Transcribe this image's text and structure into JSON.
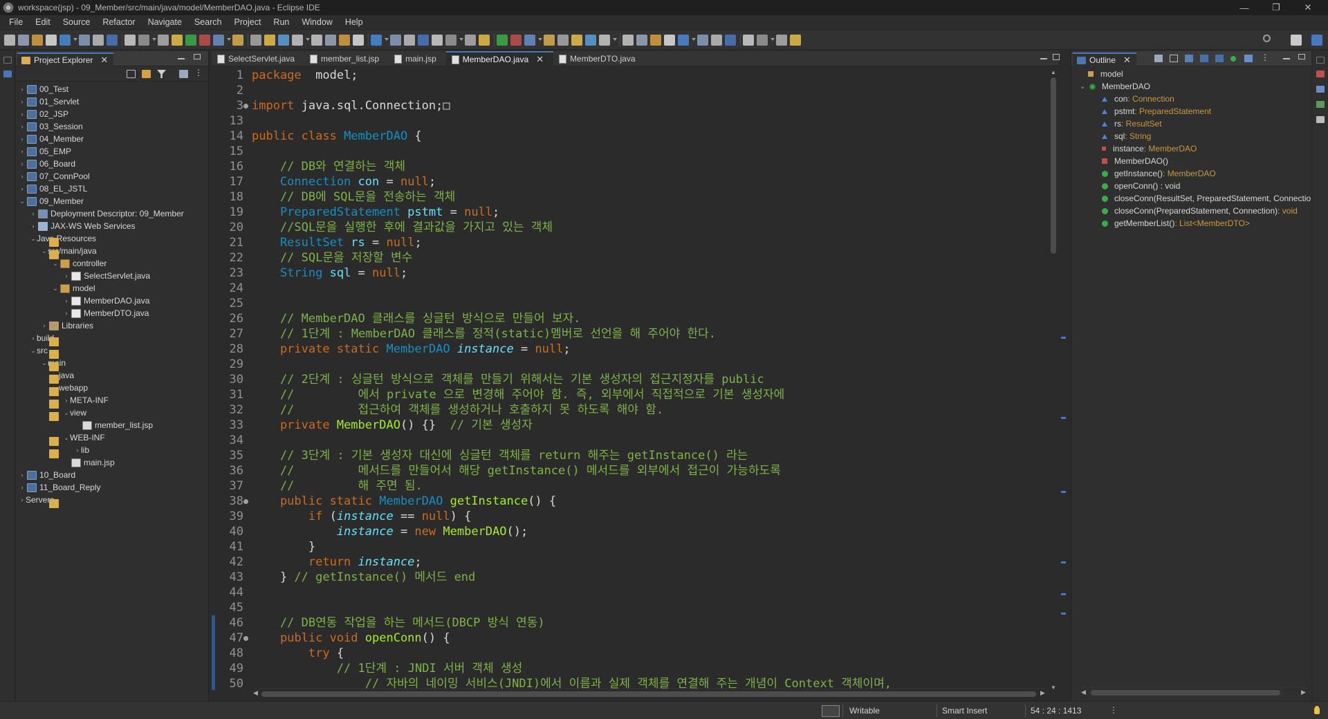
{
  "window": {
    "title": "workspace(jsp) - 09_Member/src/main/java/model/MemberDAO.java - Eclipse IDE",
    "minimize": "—",
    "restore": "❐",
    "close": "✕"
  },
  "menu": [
    "File",
    "Edit",
    "Source",
    "Refactor",
    "Navigate",
    "Search",
    "Project",
    "Run",
    "Window",
    "Help"
  ],
  "explorer": {
    "title": "Project Explorer",
    "close": "✕",
    "tree": [
      {
        "indent": 0,
        "arrow": "›",
        "icon": "proj",
        "label": "00_Test"
      },
      {
        "indent": 0,
        "arrow": "›",
        "icon": "proj",
        "label": "01_Servlet"
      },
      {
        "indent": 0,
        "arrow": "›",
        "icon": "proj",
        "label": "02_JSP"
      },
      {
        "indent": 0,
        "arrow": "›",
        "icon": "proj",
        "label": "03_Session"
      },
      {
        "indent": 0,
        "arrow": "›",
        "icon": "proj",
        "label": "04_Member"
      },
      {
        "indent": 0,
        "arrow": "›",
        "icon": "proj",
        "label": "05_EMP"
      },
      {
        "indent": 0,
        "arrow": "›",
        "icon": "proj",
        "label": "06_Board"
      },
      {
        "indent": 0,
        "arrow": "›",
        "icon": "proj",
        "label": "07_ConnPool"
      },
      {
        "indent": 0,
        "arrow": "›",
        "icon": "proj",
        "label": "08_EL_JSTL"
      },
      {
        "indent": 0,
        "arrow": "⌄",
        "icon": "proj",
        "label": "09_Member"
      },
      {
        "indent": 1,
        "arrow": "›",
        "icon": "dd",
        "label": "Deployment Descriptor: 09_Member"
      },
      {
        "indent": 1,
        "arrow": "›",
        "icon": "ws",
        "label": "JAX-WS Web Services"
      },
      {
        "indent": 1,
        "arrow": "⌄",
        "icon": "fold",
        "label": "Java Resources"
      },
      {
        "indent": 2,
        "arrow": "⌄",
        "icon": "fold",
        "label": "src/main/java"
      },
      {
        "indent": 3,
        "arrow": "⌄",
        "icon": "pkg",
        "label": "controller"
      },
      {
        "indent": 4,
        "arrow": "›",
        "icon": "java",
        "label": "SelectServlet.java"
      },
      {
        "indent": 3,
        "arrow": "⌄",
        "icon": "pkg",
        "label": "model"
      },
      {
        "indent": 4,
        "arrow": "›",
        "icon": "java",
        "label": "MemberDAO.java"
      },
      {
        "indent": 4,
        "arrow": "›",
        "icon": "java",
        "label": "MemberDTO.java"
      },
      {
        "indent": 2,
        "arrow": "›",
        "icon": "lib",
        "label": "Libraries"
      },
      {
        "indent": 1,
        "arrow": "›",
        "icon": "fold",
        "label": "build"
      },
      {
        "indent": 1,
        "arrow": "⌄",
        "icon": "fold",
        "label": "src"
      },
      {
        "indent": 2,
        "arrow": "⌄",
        "icon": "fold",
        "label": "main"
      },
      {
        "indent": 3,
        "arrow": "›",
        "icon": "fold",
        "label": "java"
      },
      {
        "indent": 3,
        "arrow": "⌄",
        "icon": "fold",
        "label": "webapp"
      },
      {
        "indent": 4,
        "arrow": "›",
        "icon": "fold",
        "label": "META-INF"
      },
      {
        "indent": 4,
        "arrow": "⌄",
        "icon": "fold",
        "label": "view"
      },
      {
        "indent": 5,
        "arrow": "",
        "icon": "jsp",
        "label": "member_list.jsp"
      },
      {
        "indent": 4,
        "arrow": "⌄",
        "icon": "fold",
        "label": "WEB-INF"
      },
      {
        "indent": 5,
        "arrow": "›",
        "icon": "fold",
        "label": "lib"
      },
      {
        "indent": 4,
        "arrow": "",
        "icon": "jsp",
        "label": "main.jsp"
      },
      {
        "indent": 0,
        "arrow": "›",
        "icon": "proj",
        "label": "10_Board"
      },
      {
        "indent": 0,
        "arrow": "›",
        "icon": "proj",
        "label": "11_Board_Reply"
      },
      {
        "indent": 0,
        "arrow": "›",
        "icon": "fold",
        "label": "Servers"
      }
    ]
  },
  "editor": {
    "tabs": [
      {
        "label": "SelectServlet.java",
        "active": false
      },
      {
        "label": "member_list.jsp",
        "active": false
      },
      {
        "label": "main.jsp",
        "active": false
      },
      {
        "label": "MemberDAO.java",
        "active": true,
        "close": "✕"
      },
      {
        "label": "MemberDTO.java",
        "active": false
      }
    ],
    "lines": [
      {
        "n": "1",
        "t": [
          [
            "k",
            "package"
          ],
          [
            "",
            "  model;"
          ]
        ]
      },
      {
        "n": "2",
        "t": []
      },
      {
        "n": "3",
        "fold": true,
        "t": [
          [
            "k",
            "import"
          ],
          [
            "",
            " java.sql.Connection;"
          ],
          [
            "",
            "□"
          ]
        ]
      },
      {
        "n": "13",
        "t": []
      },
      {
        "n": "14",
        "t": [
          [
            "k",
            "public class "
          ],
          [
            "cls",
            "MemberDAO"
          ],
          [
            "",
            " {"
          ]
        ]
      },
      {
        "n": "15",
        "t": []
      },
      {
        "n": "16",
        "t": [
          [
            "c",
            "    // DB와 연결하는 객체"
          ]
        ]
      },
      {
        "n": "17",
        "t": [
          [
            "ty",
            "    Connection "
          ],
          [
            "v",
            "con"
          ],
          [
            "",
            " = "
          ],
          [
            "n",
            "null"
          ],
          [
            "",
            ";"
          ]
        ]
      },
      {
        "n": "18",
        "t": [
          [
            "c",
            "    // DB에 SQL문을 전송하는 객체"
          ]
        ]
      },
      {
        "n": "19",
        "t": [
          [
            "ty",
            "    PreparedStatement "
          ],
          [
            "v",
            "pstmt"
          ],
          [
            "",
            " = "
          ],
          [
            "n",
            "null"
          ],
          [
            "",
            ";"
          ]
        ]
      },
      {
        "n": "20",
        "t": [
          [
            "c",
            "    //SQL문을 실행한 후에 결과값을 가지고 있는 객체"
          ]
        ]
      },
      {
        "n": "21",
        "t": [
          [
            "ty",
            "    ResultSet "
          ],
          [
            "v",
            "rs"
          ],
          [
            "",
            " = "
          ],
          [
            "n",
            "null"
          ],
          [
            "",
            ";"
          ]
        ]
      },
      {
        "n": "22",
        "t": [
          [
            "c",
            "    // SQL문을 저장할 변수"
          ]
        ]
      },
      {
        "n": "23",
        "t": [
          [
            "ty",
            "    String "
          ],
          [
            "v",
            "sql"
          ],
          [
            "",
            " = "
          ],
          [
            "n",
            "null"
          ],
          [
            "",
            ";"
          ]
        ]
      },
      {
        "n": "24",
        "t": []
      },
      {
        "n": "25",
        "t": []
      },
      {
        "n": "26",
        "t": [
          [
            "c",
            "    // MemberDAO 클래스를 싱글턴 방식으로 만들어 보자."
          ]
        ]
      },
      {
        "n": "27",
        "t": [
          [
            "c",
            "    // 1단계 : MemberDAO 클래스를 정적(static)멤버로 선언을 해 주어야 한다."
          ]
        ]
      },
      {
        "n": "28",
        "t": [
          [
            "k",
            "    private static "
          ],
          [
            "cls",
            "MemberDAO "
          ],
          [
            "fi",
            "instance"
          ],
          [
            "",
            " = "
          ],
          [
            "n",
            "null"
          ],
          [
            "",
            ";"
          ]
        ]
      },
      {
        "n": "29",
        "t": []
      },
      {
        "n": "30",
        "t": [
          [
            "c",
            "    // 2단계 : 싱글턴 방식으로 객체를 만들기 위해서는 기본 생성자의 접근지정자를 public"
          ]
        ]
      },
      {
        "n": "31",
        "t": [
          [
            "c",
            "    //         에서 private 으로 변경해 주어야 함. 즉, 외부에서 직접적으로 기본 생성자에"
          ]
        ]
      },
      {
        "n": "32",
        "t": [
          [
            "c",
            "    //         접근하여 객체를 생성하거나 호출하지 못 하도록 해야 함."
          ]
        ]
      },
      {
        "n": "33",
        "t": [
          [
            "k",
            "    private "
          ],
          [
            "f",
            "MemberDAO"
          ],
          [
            "",
            "() {}  "
          ],
          [
            "c",
            "// 기본 생성자"
          ]
        ]
      },
      {
        "n": "34",
        "t": []
      },
      {
        "n": "35",
        "t": [
          [
            "c",
            "    // 3단계 : 기본 생성자 대신에 싱글턴 객체를 return 해주는 getInstance() 라는"
          ]
        ]
      },
      {
        "n": "36",
        "t": [
          [
            "c",
            "    //         메서드를 만들어서 해당 getInstance() 메서드를 외부에서 접근이 가능하도록"
          ]
        ]
      },
      {
        "n": "37",
        "t": [
          [
            "c",
            "    //         해 주면 됨."
          ]
        ]
      },
      {
        "n": "38",
        "fold": true,
        "t": [
          [
            "k",
            "    public static "
          ],
          [
            "cls",
            "MemberDAO "
          ],
          [
            "f",
            "getInstance"
          ],
          [
            "",
            "() {"
          ]
        ]
      },
      {
        "n": "39",
        "t": [
          [
            "k",
            "        if "
          ],
          [
            "",
            "("
          ],
          [
            "fi",
            "instance"
          ],
          [
            "",
            " == "
          ],
          [
            "n",
            "null"
          ],
          [
            "",
            ") {"
          ]
        ]
      },
      {
        "n": "40",
        "t": [
          [
            "fi",
            "            instance"
          ],
          [
            "",
            " = "
          ],
          [
            "k",
            "new "
          ],
          [
            "f",
            "MemberDAO"
          ],
          [
            "",
            "();"
          ]
        ]
      },
      {
        "n": "41",
        "t": [
          [
            "",
            "        }"
          ]
        ]
      },
      {
        "n": "42",
        "t": [
          [
            "k",
            "        return "
          ],
          [
            "fi",
            "instance"
          ],
          [
            "",
            ";"
          ]
        ]
      },
      {
        "n": "43",
        "t": [
          [
            "",
            "    } "
          ],
          [
            "c",
            "// getInstance() 메서드 end"
          ]
        ]
      },
      {
        "n": "44",
        "t": []
      },
      {
        "n": "45",
        "t": []
      },
      {
        "n": "46",
        "mark": true,
        "t": [
          [
            "c",
            "    // DB연동 작업을 하는 메서드(DBCP 방식 연동)"
          ]
        ]
      },
      {
        "n": "47",
        "fold": true,
        "mark": true,
        "t": [
          [
            "k",
            "    public void "
          ],
          [
            "f",
            "openConn"
          ],
          [
            "",
            "() {"
          ]
        ]
      },
      {
        "n": "48",
        "mark": true,
        "t": [
          [
            "k",
            "        try "
          ],
          [
            "",
            "{"
          ]
        ]
      },
      {
        "n": "49",
        "mark": true,
        "t": [
          [
            "c",
            "            // 1단계 : JNDI 서버 객체 생성"
          ]
        ]
      },
      {
        "n": "50",
        "mark": true,
        "t": [
          [
            "c",
            "                // 자바의 네이밍 서비스(JNDI)에서 이름과 실제 객체를 연결해 주는 개념이 Context 객체이며,"
          ]
        ]
      }
    ]
  },
  "outline": {
    "title": "Outline",
    "close": "✕",
    "items": [
      {
        "indent": 0,
        "kind": "pkg",
        "label": "model",
        "type": ""
      },
      {
        "indent": 0,
        "kind": "class",
        "label": "MemberDAO",
        "type": ""
      },
      {
        "indent": 1,
        "kind": "field",
        "label": "con",
        "type": " : Connection"
      },
      {
        "indent": 1,
        "kind": "field",
        "label": "pstmt",
        "type": " : PreparedStatement"
      },
      {
        "indent": 1,
        "kind": "field",
        "label": "rs",
        "type": " : ResultSet"
      },
      {
        "indent": 1,
        "kind": "field",
        "label": "sql",
        "type": " : String"
      },
      {
        "indent": 1,
        "kind": "privstatic",
        "label": "instance",
        "type": " : MemberDAO"
      },
      {
        "indent": 1,
        "kind": "priv",
        "label": "MemberDAO()",
        "type": ""
      },
      {
        "indent": 1,
        "kind": "pubstatic",
        "label": "getInstance()",
        "type": " : MemberDAO"
      },
      {
        "indent": 1,
        "kind": "pub",
        "label": "openConn() : void",
        "type": ""
      },
      {
        "indent": 1,
        "kind": "pub",
        "label": "closeConn(ResultSet, PreparedStatement, Connectio",
        "type": ""
      },
      {
        "indent": 1,
        "kind": "pub",
        "label": "closeConn(PreparedStatement, Connection)",
        "type": " : void"
      },
      {
        "indent": 1,
        "kind": "pub",
        "label": "getMemberList()",
        "type": " : List<MemberDTO>"
      }
    ]
  },
  "status": {
    "writable": "Writable",
    "insert": "Smart Insert",
    "position": "54 : 24 : 1413"
  }
}
